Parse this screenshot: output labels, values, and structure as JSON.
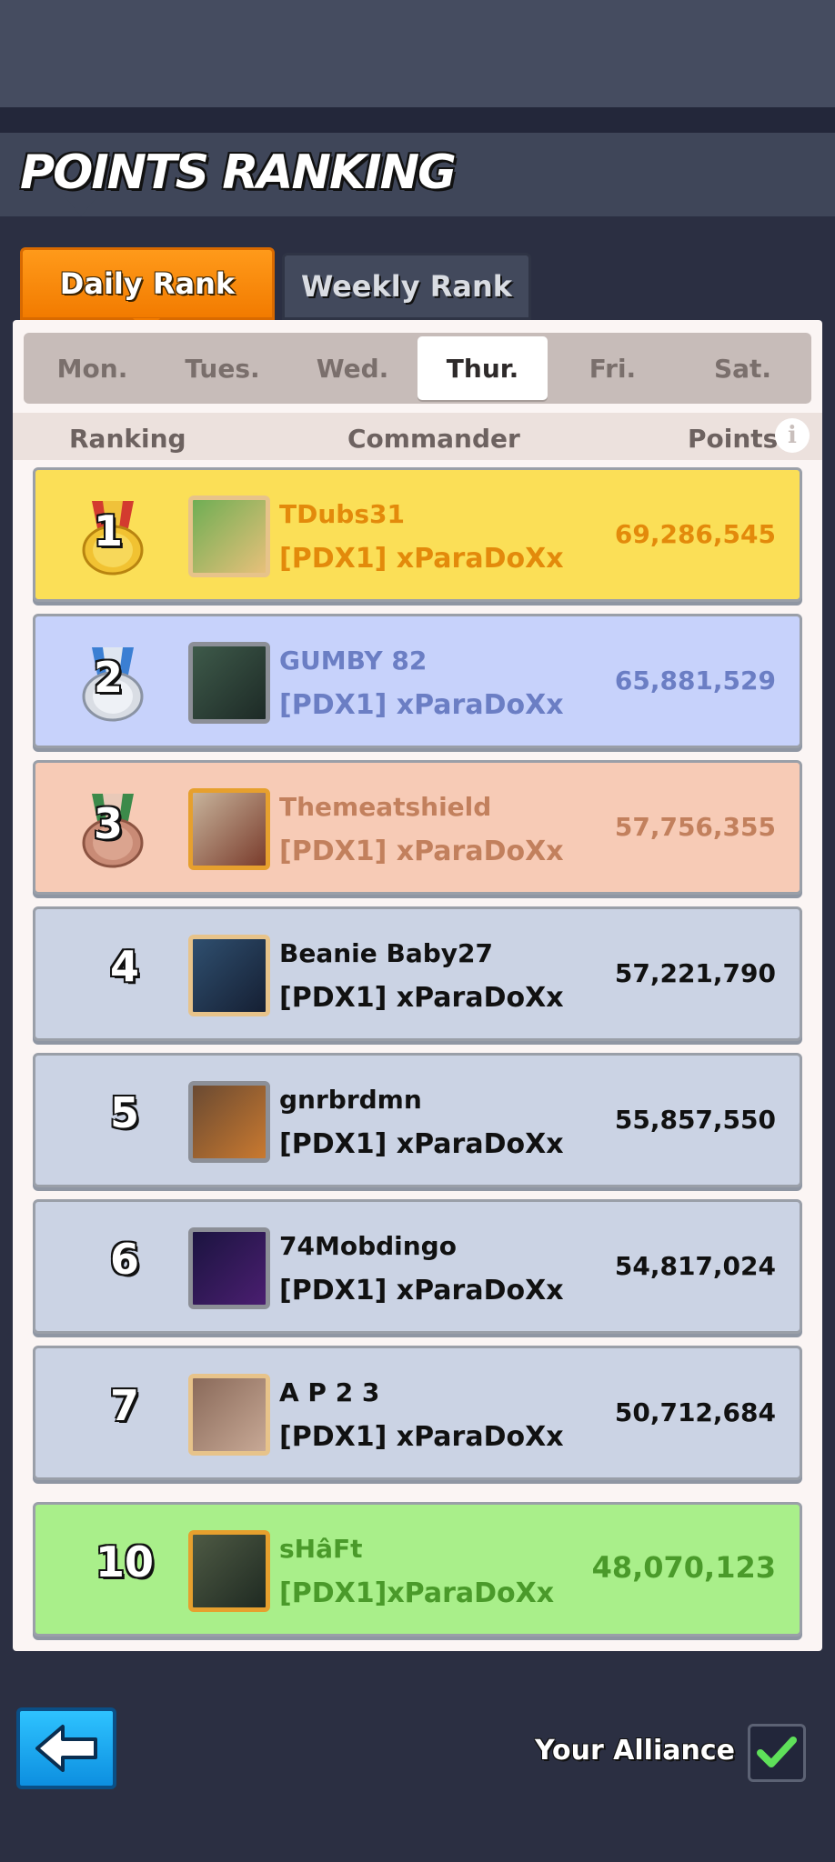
{
  "header": {
    "title": "POINTS RANKING"
  },
  "tabs": [
    {
      "label": "Daily Rank",
      "active": true
    },
    {
      "label": "Weekly Rank",
      "active": false
    }
  ],
  "days": [
    {
      "label": "Mon.",
      "active": false
    },
    {
      "label": "Tues.",
      "active": false
    },
    {
      "label": "Wed.",
      "active": false
    },
    {
      "label": "Thur.",
      "active": true
    },
    {
      "label": "Fri.",
      "active": false
    },
    {
      "label": "Sat.",
      "active": false
    }
  ],
  "columns": {
    "ranking": "Ranking",
    "commander": "Commander",
    "points": "Points",
    "info_icon": "i"
  },
  "rows": [
    {
      "rank": "1",
      "name": "TDubs31",
      "alliance": "[PDX1] xParaDoXx",
      "points": "69,286,545",
      "style": "gold",
      "medal": "gold-medal-icon"
    },
    {
      "rank": "2",
      "name": "GUMBY 82",
      "alliance": "[PDX1] xParaDoXx",
      "points": "65,881,529",
      "style": "silver",
      "medal": "silver-medal-icon"
    },
    {
      "rank": "3",
      "name": "Themeatshield",
      "alliance": "[PDX1] xParaDoXx",
      "points": "57,756,355",
      "style": "bronze",
      "medal": "bronze-medal-icon"
    },
    {
      "rank": "4",
      "name": "Beanie Baby27",
      "alliance": "[PDX1] xParaDoXx",
      "points": "57,221,790",
      "style": "normal"
    },
    {
      "rank": "5",
      "name": "gnrbrdmn",
      "alliance": "[PDX1] xParaDoXx",
      "points": "55,857,550",
      "style": "normal"
    },
    {
      "rank": "6",
      "name": "74Mobdingo",
      "alliance": "[PDX1] xParaDoXx",
      "points": "54,817,024",
      "style": "normal"
    },
    {
      "rank": "7",
      "name": "A P 2 3",
      "alliance": "[PDX1] xParaDoXx",
      "points": "50,712,684",
      "style": "normal"
    }
  ],
  "self_row": {
    "rank": "10",
    "name": "sHâFt",
    "alliance": "[PDX1]xParaDoXx",
    "points": "48,070,123"
  },
  "footer": {
    "back_icon": "back-arrow-icon",
    "your_alliance_label": "Your Alliance",
    "checkbox_checked": true
  },
  "colors": {
    "gold_bg": "#fbdf57",
    "gold_text": "#e38a0b",
    "silver_bg": "#c7d2fb",
    "silver_text": "#6b7ec4",
    "bronze_bg": "#f7cbb6",
    "bronze_text": "#c2805d",
    "normal_bg": "#cbd3e4",
    "self_bg": "#a9ef8a",
    "self_text": "#4a9a2a",
    "accent_orange": "#f48a0c"
  }
}
